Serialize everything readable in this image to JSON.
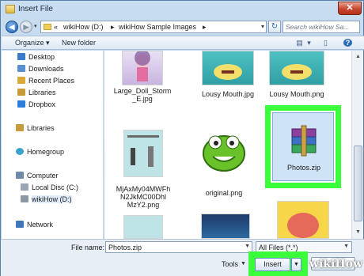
{
  "window": {
    "title": "Insert File",
    "close_glyph": "✕"
  },
  "address_bar": {
    "history_glyph": "«",
    "crumbs": [
      "wikiHow (D:)",
      "wikiHow Sample Images"
    ],
    "separator": "▸",
    "dropdown_glyph": "▾"
  },
  "search": {
    "placeholder": "Search wikiHow Sa..."
  },
  "toolbar": {
    "organize_label": "Organize ▾",
    "new_folder_label": "New folder"
  },
  "sidebar": {
    "items": [
      {
        "label": "Desktop",
        "icon": "desktop-icon"
      },
      {
        "label": "Downloads",
        "icon": "downloads-icon"
      },
      {
        "label": "Recent Places",
        "icon": "recent-places-icon"
      },
      {
        "label": "Libraries",
        "icon": "libraries-icon"
      },
      {
        "label": "Dropbox",
        "icon": "dropbox-icon"
      },
      {
        "label": "Libraries",
        "icon": "libraries-icon"
      },
      {
        "label": "Homegroup",
        "icon": "homegroup-icon"
      },
      {
        "label": "Computer",
        "icon": "computer-icon"
      },
      {
        "label": "Local Disc (C:)",
        "icon": "local-disk-icon"
      },
      {
        "label": "wikiHow (D:)",
        "icon": "drive-icon"
      },
      {
        "label": "Network",
        "icon": "network-icon"
      }
    ]
  },
  "files": [
    {
      "name_line1": "Large_Doll_Storm",
      "name_line2": "_E.jpg"
    },
    {
      "name_line1": "Lousy Mouth.jpg",
      "name_line2": ""
    },
    {
      "name_line1": "Lousy Mouth.png",
      "name_line2": ""
    },
    {
      "name_line1": "MjAxMy04MWFh",
      "name_line2": "N2JkMC00Dhl",
      "name_line3": "MzY2.png"
    },
    {
      "name_line1": "original.png",
      "name_line2": ""
    },
    {
      "name_line1": "Photos.zip",
      "name_line2": ""
    }
  ],
  "bottom": {
    "file_name_label": "File name:",
    "file_name_value": "Photos.zip",
    "file_type_value": "All Files (*.*)",
    "tools_label": "Tools",
    "insert_label": "Insert",
    "cancel_label": "Cancel"
  },
  "colors": {
    "highlight": "#3bff3b",
    "accent": "#1f5fae"
  },
  "watermark": {
    "text": "wikiHow"
  }
}
